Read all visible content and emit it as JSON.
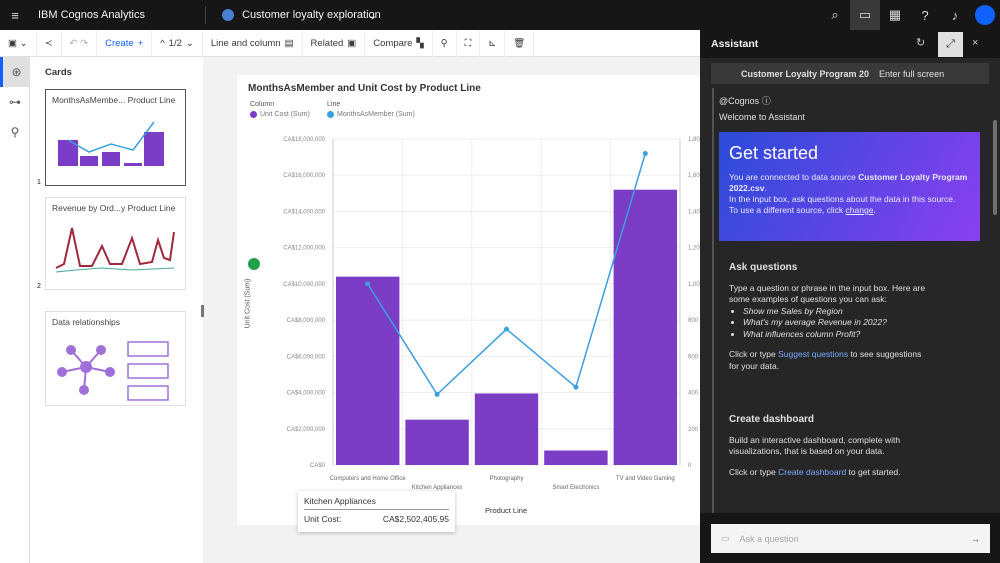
{
  "topbar": {
    "app_title": "IBM Cognos Analytics",
    "workspace_title": "Customer loyalty exploration",
    "icons": [
      "menu-icon",
      "search-icon",
      "chat-icon",
      "dashboard-icon",
      "help-icon",
      "notification-icon",
      "user-avatar-icon"
    ]
  },
  "toolbar": {
    "create": "Create",
    "page": "1/2",
    "viz_type": "Line and column",
    "related": "Related",
    "compare": "Compare"
  },
  "cards": {
    "heading": "Cards",
    "items": [
      {
        "title": "MonthsAsMembe... Product Line",
        "index": "1"
      },
      {
        "title": "Revenue by Ord...y Product Line",
        "index": "2"
      },
      {
        "title": "Data relationships"
      }
    ]
  },
  "chart_data": {
    "type": "bar+line",
    "title": "MonthsAsMember and Unit Cost by Product Line",
    "legend": {
      "column_heading": "Column",
      "line_heading": "Line",
      "placement": "top-left"
    },
    "categories": [
      "Computers and Home Office",
      "Kitchen Appliances",
      "Photography",
      "Smart Electronics",
      "TV and Video Gaming"
    ],
    "series": [
      {
        "name": "Unit Cost (Sum)",
        "type": "bar",
        "axis": "left",
        "color": "#7b3cc6",
        "values": [
          10400000,
          2502405.95,
          3950000,
          800000,
          15200000
        ]
      },
      {
        "name": "MonthsAsMember (Sum)",
        "type": "line",
        "axis": "right",
        "color": "#3aa0e0",
        "values": [
          1000,
          390,
          750,
          430,
          1720
        ]
      }
    ],
    "xlabel": "Product Line",
    "ylabel": "Unit Cost (Sum)",
    "ylim": [
      0,
      18000000
    ],
    "y2lim": [
      0,
      1800
    ],
    "yticks": [
      "CA$0",
      "CA$2,000,000",
      "CA$4,000,000",
      "CA$6,000,000",
      "CA$8,000,000",
      "CA$10,000,000",
      "CA$12,000,000",
      "CA$14,000,000",
      "CA$16,000,000",
      "CA$18,000,000"
    ],
    "y2ticks": [
      "0",
      "200",
      "400",
      "600",
      "800",
      "1,000",
      "1,200",
      "1,400",
      "1,600",
      "1,800"
    ],
    "grid": true,
    "tooltip": {
      "category": "Kitchen Appliances",
      "label": "Unit Cost:",
      "value": "CA$2,502,405.95"
    }
  },
  "assistant": {
    "title": "Assistant",
    "source_button": "Customer Loyalty Program 20",
    "tooltip": "Enter full screen",
    "sender": "@Cognos",
    "welcome": "Welcome to Assistant",
    "get_started": {
      "title": "Get started",
      "p1": "You are connected to data source ",
      "p1_bold": "Customer Loyalty Program 2022.csv",
      "p1_end": ".",
      "p2": "In the input box, ask questions about the data in this source.",
      "p3": "To use a different source, click ",
      "p3_link": "change",
      "p3_end": "."
    },
    "ask": {
      "title": "Ask questions",
      "intro": "Type a question or phrase in the input box. Here are some examples of questions you can ask:",
      "examples": [
        "Show me Sales by Region",
        "What's my average Revenue in 2022?",
        "What influences column Profit?"
      ],
      "s1": "Click or type ",
      "s1_link": "Suggest questions",
      "s1_end": " to see suggestions for your data."
    },
    "dash": {
      "title": "Create dashboard",
      "p1": "Build an interactive dashboard, complete with visualizations, that is based on your data.",
      "p2": "Click or type ",
      "p2_link": "Create dashboard",
      "p2_end": " to get started."
    },
    "input_placeholder": "Ask a question"
  },
  "colors": {
    "accent": "#0f62fe",
    "bar": "#7b3cc6",
    "line": "#3aa0e0"
  }
}
